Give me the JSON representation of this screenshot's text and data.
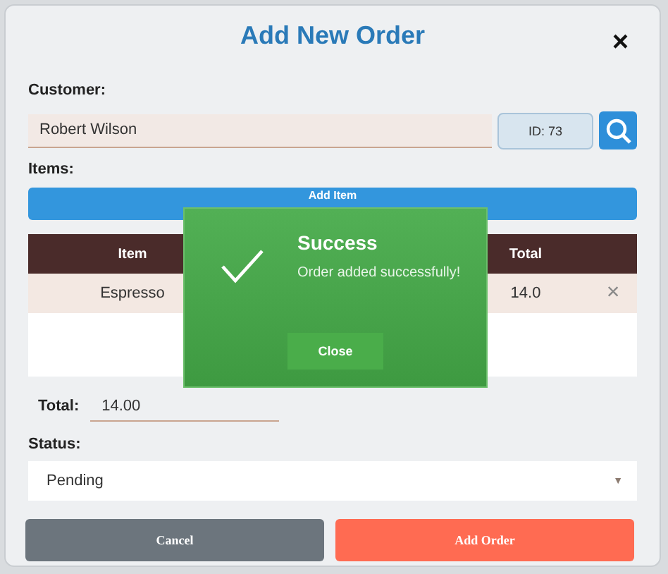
{
  "dialog": {
    "title": "Add New Order",
    "close": "×"
  },
  "customer": {
    "label": "Customer:",
    "value": "Robert Wilson",
    "id_badge": "ID: 73"
  },
  "items": {
    "label": "Items:",
    "add_button": "Add Item",
    "columns": [
      {
        "label": "Item"
      },
      {
        "label": "Total"
      }
    ],
    "rows": [
      {
        "item": "Espresso",
        "total": "14.0",
        "remove": "×"
      }
    ]
  },
  "total": {
    "label": "Total:",
    "value": "14.00"
  },
  "status": {
    "label": "Status:",
    "value": "Pending",
    "caret": "▼"
  },
  "buttons": [
    {
      "label": "Cancel",
      "kind": "secondary"
    },
    {
      "label": "Add Order",
      "kind": "primary"
    }
  ],
  "popup": {
    "title": "Success",
    "message": "Order added successfully!",
    "button": "Close"
  }
}
